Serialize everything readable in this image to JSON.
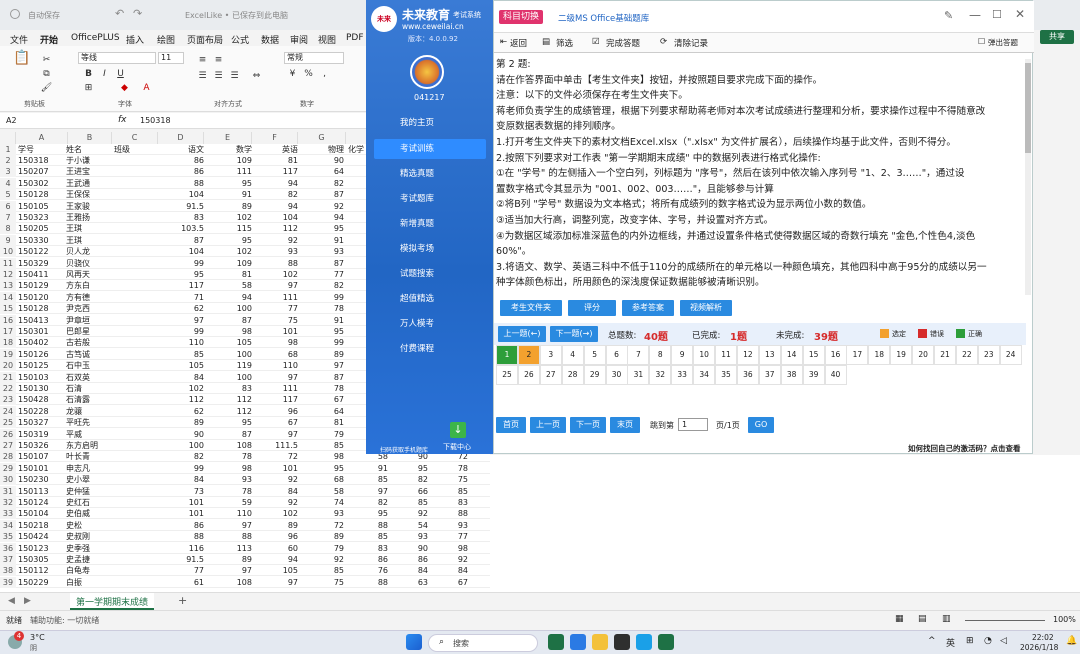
{
  "excel": {
    "title_autosave": "自动保存",
    "title_file": "ExcelLike • 已保存到此电脑",
    "menu": [
      "文件",
      "开始",
      "OfficePLUS",
      "插入",
      "绘图",
      "页面布局",
      "公式",
      "数据",
      "审阅",
      "视图",
      "PDF"
    ],
    "share": "共享",
    "font_name": "等线",
    "font_size": "11",
    "number_format": "常规",
    "groups": [
      "剪贴板",
      "字体",
      "对齐方式",
      "数字"
    ],
    "name_box": "A2",
    "formula_value": "150318",
    "col_letters": [
      "A",
      "B",
      "C",
      "D",
      "E",
      "F",
      "G",
      "H"
    ],
    "headers": [
      "学号",
      "姓名",
      "班级",
      "语文",
      "数学",
      "英语",
      "物理",
      "化学"
    ],
    "rows": [
      [
        "150318",
        "于小谦",
        "",
        "86",
        "109",
        "81",
        "90"
      ],
      [
        "150207",
        "王进宝",
        "",
        "86",
        "111",
        "117",
        "64"
      ],
      [
        "150302",
        "王武通",
        "",
        "88",
        "95",
        "94",
        "82"
      ],
      [
        "150128",
        "王保保",
        "",
        "104",
        "91",
        "82",
        "87"
      ],
      [
        "150105",
        "王家骏",
        "",
        "91.5",
        "89",
        "94",
        "92"
      ],
      [
        "150323",
        "王雅扬",
        "",
        "83",
        "102",
        "104",
        "94"
      ],
      [
        "150205",
        "王琪",
        "",
        "103.5",
        "115",
        "112",
        "95"
      ],
      [
        "150330",
        "王琪",
        "",
        "87",
        "95",
        "92",
        "91"
      ],
      [
        "150122",
        "贝人龙",
        "",
        "104",
        "102",
        "93",
        "93"
      ],
      [
        "150329",
        "贝骁仪",
        "",
        "99",
        "109",
        "88",
        "87"
      ],
      [
        "150411",
        "风再天",
        "",
        "95",
        "81",
        "102",
        "77"
      ],
      [
        "150129",
        "方东白",
        "",
        "117",
        "58",
        "97",
        "82"
      ],
      [
        "150120",
        "方有德",
        "",
        "71",
        "94",
        "111",
        "99"
      ],
      [
        "150128",
        "尹克西",
        "",
        "62",
        "100",
        "77",
        "78"
      ],
      [
        "150413",
        "尹章垣",
        "",
        "97",
        "87",
        "75",
        "91"
      ],
      [
        "150301",
        "巴郎星",
        "",
        "99",
        "98",
        "101",
        "95"
      ],
      [
        "150402",
        "古若般",
        "",
        "110",
        "105",
        "98",
        "99"
      ],
      [
        "150126",
        "古笃诚",
        "",
        "85",
        "100",
        "68",
        "89"
      ],
      [
        "150125",
        "石中玉",
        "",
        "105",
        "119",
        "110",
        "97"
      ],
      [
        "150103",
        "石双英",
        "",
        "84",
        "100",
        "97",
        "87"
      ],
      [
        "150130",
        "石清",
        "",
        "102",
        "83",
        "111",
        "78"
      ],
      [
        "150428",
        "石清露",
        "",
        "112",
        "112",
        "117",
        "67"
      ],
      [
        "150228",
        "龙骧",
        "",
        "62",
        "112",
        "96",
        "64"
      ],
      [
        "150327",
        "平旺先",
        "",
        "89",
        "95",
        "67",
        "81"
      ],
      [
        "150319",
        "平威",
        "",
        "90",
        "87",
        "97",
        "79"
      ],
      [
        "150326",
        "东方启明",
        "",
        "100",
        "108",
        "111.5",
        "85"
      ],
      [
        "150107",
        "叶长青",
        "",
        "82",
        "78",
        "72",
        "98"
      ],
      [
        "150101",
        "申志凡",
        "",
        "99",
        "98",
        "101",
        "95"
      ],
      [
        "150230",
        "史小翠",
        "",
        "84",
        "93",
        "92",
        "68"
      ],
      [
        "150113",
        "史仲猛",
        "",
        "73",
        "78",
        "84",
        "58"
      ],
      [
        "150124",
        "史红石",
        "",
        "101",
        "59",
        "92",
        "74"
      ],
      [
        "150104",
        "史伯威",
        "",
        "101",
        "110",
        "102",
        "93"
      ],
      [
        "150218",
        "史松",
        "",
        "86",
        "97",
        "89",
        "72"
      ],
      [
        "150424",
        "史叔刚",
        "",
        "88",
        "88",
        "96",
        "89"
      ],
      [
        "150123",
        "史季强",
        "",
        "116",
        "113",
        "60",
        "79"
      ],
      [
        "150305",
        "史孟捷",
        "",
        "91.5",
        "89",
        "94",
        "92"
      ],
      [
        "150112",
        "白龟寿",
        "",
        "77",
        "97",
        "105",
        "85"
      ],
      [
        "150229",
        "白振",
        "",
        "61",
        "108",
        "97",
        "75"
      ]
    ],
    "extra_right": [
      [
        "58",
        "90",
        "72"
      ],
      [
        "91",
        "95",
        "78"
      ],
      [
        "85",
        "82",
        "75"
      ],
      [
        "97",
        "66",
        "85"
      ],
      [
        "82",
        "85",
        "83"
      ],
      [
        "95",
        "92",
        "88"
      ],
      [
        "88",
        "54",
        "93"
      ],
      [
        "85",
        "93",
        "77"
      ],
      [
        "83",
        "90",
        "98"
      ],
      [
        "86",
        "86",
        "92"
      ],
      [
        "76",
        "84",
        "84"
      ],
      [
        "88",
        "63",
        "67"
      ]
    ],
    "sheet_tab": "第一学期期末成绩",
    "status_ready": "就绪",
    "status_access": "辅助功能: 一切就绪",
    "zoom": "100%"
  },
  "app": {
    "brand": "未来教育",
    "brand_sub": "考试系统",
    "site": "www.ceweilai.cn",
    "version": "版本：4.0.0.92",
    "user_id": "041217",
    "nav": [
      "我的主页",
      "考试训练",
      "精选真题",
      "考试题库",
      "新增真题",
      "模拟考场",
      "试题搜索",
      "超值精选",
      "万人模考",
      "付费课程"
    ],
    "qr_caption": "扫码获取手机题库",
    "download": "下载中心",
    "tag": "科目切换",
    "subject": "二级MS Office基础题库",
    "toolbar": [
      "返回",
      "筛选",
      "完成答题",
      "清除记录"
    ],
    "pop_out": "弹出答题",
    "question": [
      "第 2 题:",
      "请在作答界面中单击【考生文件夹】按钮，并按照题目要求完成下面的操作。",
      "注意：以下的文件必须保存在考生文件夹下。",
      "蒋老师负责学生的成绩管理，根据下列要求帮助蒋老师对本次考试成绩进行整理和分析，要求操作过程中不得随意改",
      "变原数据表数据的排列顺序。",
      "1.打开考生文件夹下的素材文档Excel.xlsx（\".xlsx\" 为文件扩展名），后续操作均基于此文件，否则不得分。",
      "2.按照下列要求对工作表 \"第一学期期末成绩\" 中的数据列表进行格式化操作:",
      "①在 \"学号\" 的左侧插入一个空白列，列标题为 \"序号\"，然后在该列中依次输入序列号 \"1、2、3……\"，通过设",
      "置数字格式令其显示为 \"001、002、003……\"，且能够参与计算",
      "②将B列 \"学号\" 数据设为文本格式；将所有成绩列的数字格式设为显示两位小数的数值。",
      "③适当加大行高，调整列宽，改变字体、字号，并设置对齐方式。",
      "④为数据区域添加标准深蓝色的内外边框线，并通过设置条件格式使得数据区域的奇数行填充 \"金色,个性色4,淡色",
      "60%\"。",
      "3.将语文、数学、英语三科中不低于110分的成绩所在的单元格以一种颜色填充，其他四科中高于95分的成绩以另一",
      "种字体颜色标出，所用颜色的深浅度保证数据能够被清晰识别。"
    ],
    "action_buttons": [
      "考生文件夹",
      "评分",
      "参考答案",
      "视频解析"
    ],
    "prev_q": "上一题(←)",
    "next_q": "下一题(→)",
    "total_label": "总题数:",
    "total": "40题",
    "done_label": "已完成:",
    "done": "1题",
    "todo_label": "未完成:",
    "todo": "39题",
    "legend": [
      "选定",
      "错误",
      "正确"
    ],
    "legend_colors": [
      "#f3a12e",
      "#d62b2b",
      "#2d9e3a"
    ],
    "numbers": [
      "1",
      "2",
      "3",
      "4",
      "5",
      "6",
      "7",
      "8",
      "9",
      "10",
      "11",
      "12",
      "13",
      "14",
      "15",
      "16",
      "17",
      "18",
      "19",
      "20",
      "21",
      "22",
      "23",
      "24",
      "25",
      "26",
      "27",
      "28",
      "29",
      "30",
      "31",
      "32",
      "33",
      "34",
      "35",
      "36",
      "37",
      "38",
      "39",
      "40"
    ],
    "page_buttons": [
      "首页",
      "上一页",
      "下一页",
      "末页"
    ],
    "jump_label": "跳到第",
    "page_select": "1",
    "page_of": "页/1页",
    "go": "GO",
    "help": "如何找回自己的激活码？点击查看"
  },
  "taskbar": {
    "weather_temp": "3°C",
    "weather_desc": "阴",
    "search": "搜索",
    "lang": "英",
    "time": "22:02",
    "date": "2026/1/18",
    "badge": "4"
  }
}
